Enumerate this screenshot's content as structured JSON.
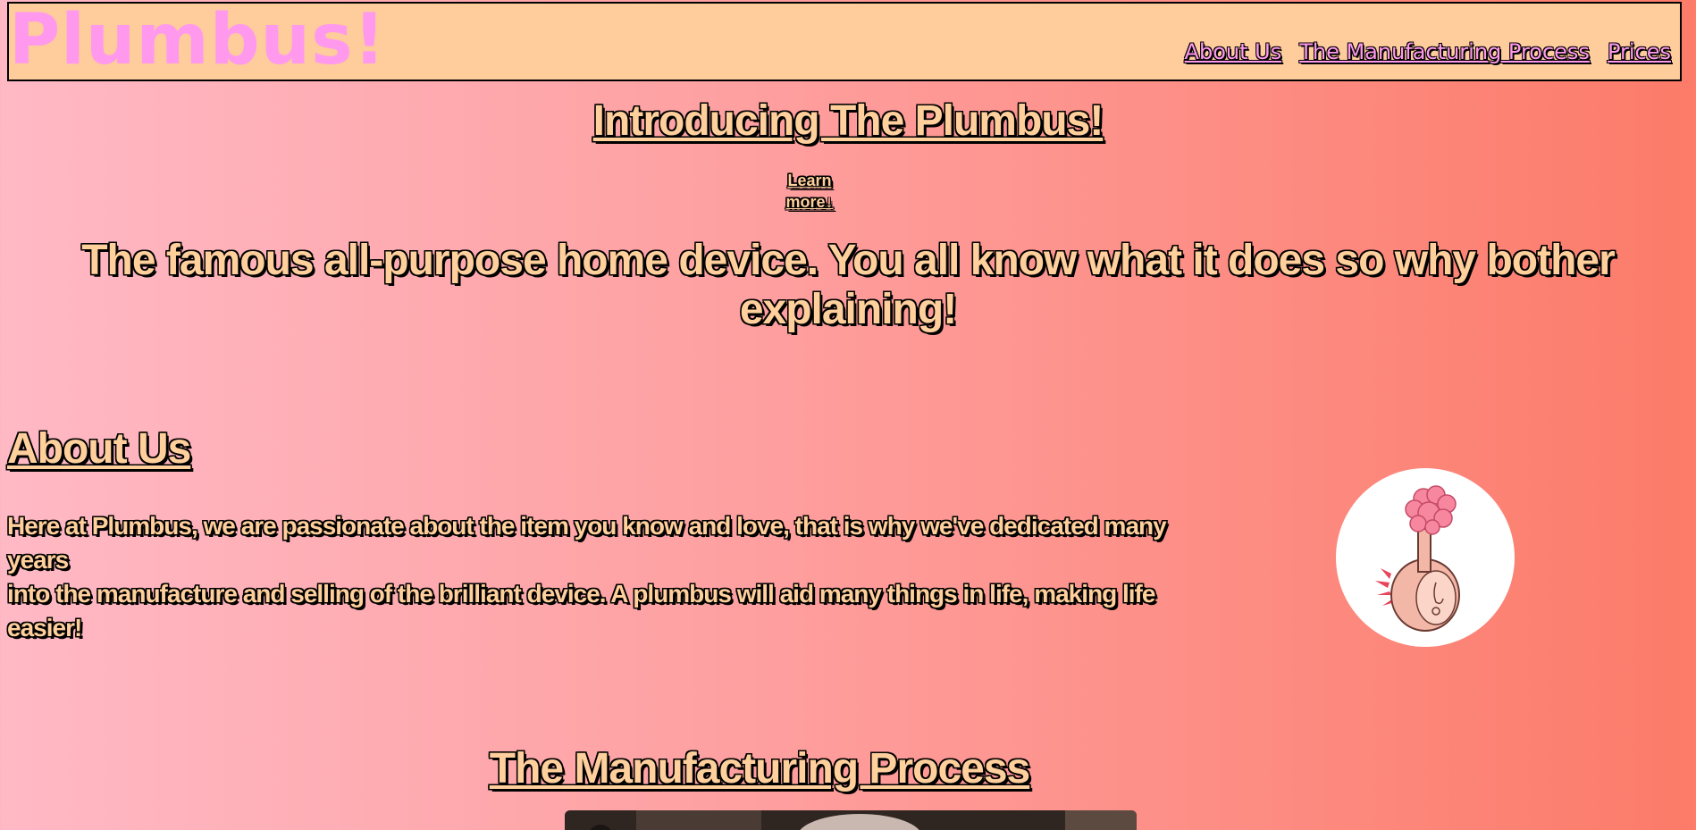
{
  "header": {
    "logo": "Plumbus!",
    "nav": [
      {
        "label": "About Us"
      },
      {
        "label": "The Manufacturing Process"
      },
      {
        "label": "Prices"
      }
    ]
  },
  "hero": {
    "title": "Introducing The Plumbus!",
    "learn_more_line1": "Learn",
    "learn_more_line2": "more↓",
    "tagline": "The famous all-purpose home device. You all know what it does so why bother explaining!"
  },
  "about": {
    "title": "About Us",
    "text_line1": "Here at Plumbus, we are passionate about the item you know and love, that is why we've dedicated many years",
    "text_line2": "into the manufacture and selling of the brilliant device. A plumbus will aid many things in life, making life easier!"
  },
  "manufacturing": {
    "title": "The Manufacturing Process"
  },
  "colors": {
    "header_bg": "#ffcc9c",
    "logo": "#ff99ee",
    "text_fill": "#ffcf9c",
    "gradient_start": "#ffb9c5",
    "gradient_end": "#fc7b69"
  }
}
